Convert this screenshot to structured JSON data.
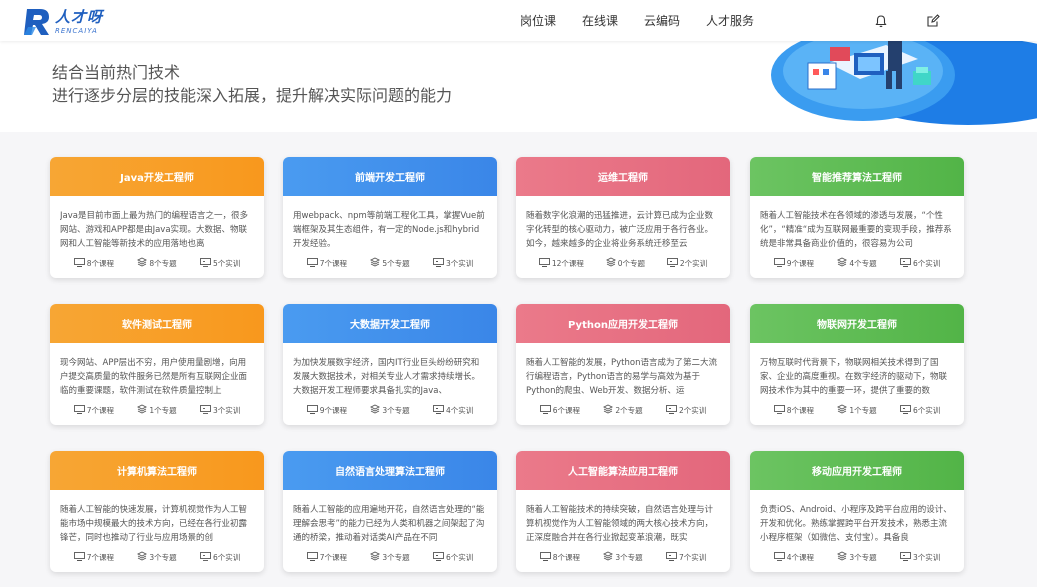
{
  "logo": {
    "cn": "人才呀",
    "en": "RENCAIYA"
  },
  "nav": [
    "岗位课",
    "在线课",
    "云编码",
    "人才服务"
  ],
  "hero": {
    "line1": "结合当前热门技术",
    "line2": "进行逐步分层的技能深入拓展，提升解决实际问题的能力"
  },
  "colors": {
    "orange": "#f8981d",
    "blue": "#3a86e8",
    "pink": "#e3677c",
    "green": "#52b447"
  },
  "cards": [
    {
      "title": "Java开发工程师",
      "theme": "orange",
      "desc": "Java是目前市面上最为热门的编程语言之一，很多网站、游戏和APP都是由Java实现。大数据、物联网和人工智能等新技术的应用落地也离",
      "courses": "8个课程",
      "topics": "8个专题",
      "labs": "5个实训"
    },
    {
      "title": "前端开发工程师",
      "theme": "blue",
      "desc": "用webpack、npm等前端工程化工具，掌握Vue前端框架及其生态组件，有一定的Node.js和hybrid开发经验。",
      "courses": "7个课程",
      "topics": "5个专题",
      "labs": "3个实训"
    },
    {
      "title": "运维工程师",
      "theme": "pink",
      "desc": "随着数字化浪潮的迅猛推进，云计算已成为企业数字化转型的核心驱动力，被广泛应用于各行各业。如今，越来越多的企业将业务系统迁移至云",
      "courses": "12个课程",
      "topics": "0个专题",
      "labs": "2个实训"
    },
    {
      "title": "智能推荐算法工程师",
      "theme": "green",
      "desc": "随着人工智能技术在各领域的渗透与发展，“个性化”，“精准“成为互联网最重要的变现手段，推荐系统是非常具备商业价值的，很容易为公司",
      "courses": "9个课程",
      "topics": "4个专题",
      "labs": "6个实训"
    },
    {
      "title": "软件测试工程师",
      "theme": "orange",
      "desc": "现今网站、APP层出不穷，用户使用量剧增，向用户提交高质量的软件服务已然是所有互联网企业面临的重要课题，软件测试在软件质量控制上",
      "courses": "7个课程",
      "topics": "1个专题",
      "labs": "3个实训"
    },
    {
      "title": "大数据开发工程师",
      "theme": "blue",
      "desc": "为加快发展数字经济，国内IT行业巨头纷纷研究和发展大数据技术，对相关专业人才需求持续增长。大数据开发工程师要求具备扎实的Java、",
      "courses": "9个课程",
      "topics": "3个专题",
      "labs": "4个实训"
    },
    {
      "title": "Python应用开发工程师",
      "theme": "pink",
      "desc": "随着人工智能的发展，Python语言成为了第二大流行编程语言，Python语言的易学与高效为基于Python的爬虫、Web开发、数据分析、运",
      "courses": "6个课程",
      "topics": "2个专题",
      "labs": "2个实训"
    },
    {
      "title": "物联网开发工程师",
      "theme": "green",
      "desc": "万物互联时代背景下，物联网相关技术得到了国家、企业的高度重视。在数字经济的驱动下，物联网技术作为其中的重要一环，提供了重要的数",
      "courses": "8个课程",
      "topics": "1个专题",
      "labs": "6个实训"
    },
    {
      "title": "计算机算法工程师",
      "theme": "orange",
      "desc": "随着人工智能的快速发展，计算机视觉作为人工智能市场中规模最大的技术方向，已经在各行业初露锋芒，同时也推动了行业与应用场景的创",
      "courses": "7个课程",
      "topics": "3个专题",
      "labs": "6个实训"
    },
    {
      "title": "自然语言处理算法工程师",
      "theme": "blue",
      "desc": "随着人工智能的应用遍地开花，自然语言处理的“能理解会思考”的能力已经为人类和机器之间架起了沟通的桥梁，推动着对话类AI产品在不同",
      "courses": "7个课程",
      "topics": "3个专题",
      "labs": "6个实训"
    },
    {
      "title": "人工智能算法应用工程师",
      "theme": "pink",
      "desc": "随着人工智能技术的持续突破，自然语言处理与计算机视觉作为人工智能领域的两大核心技术方向，正深度融合并在各行业掀起变革浪潮，既实",
      "courses": "8个课程",
      "topics": "3个专题",
      "labs": "7个实训"
    },
    {
      "title": "移动应用开发工程师",
      "theme": "green",
      "desc": "负责iOS、Android、小程序及跨平台应用的设计、开发和优化。熟练掌握跨平台开发技术，熟悉主流小程序框架（如微信、支付宝）。具备良",
      "courses": "4个课程",
      "topics": "3个专题",
      "labs": "3个实训"
    }
  ]
}
